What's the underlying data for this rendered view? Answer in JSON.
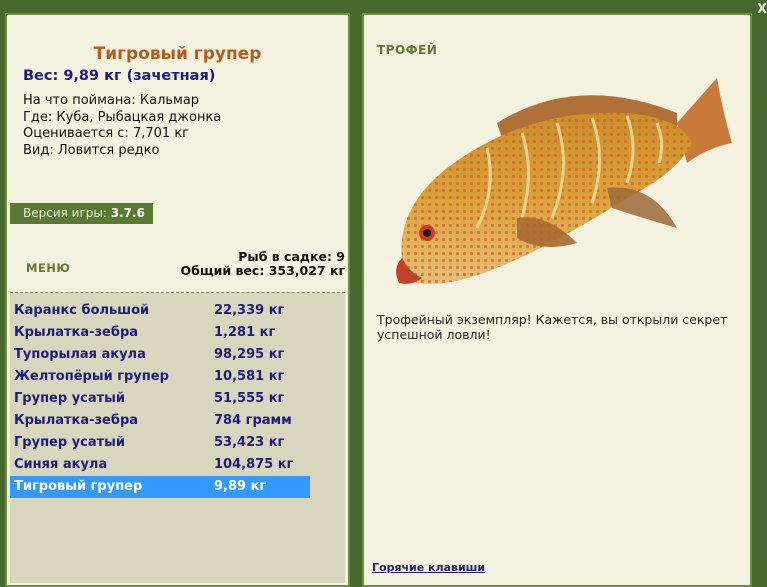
{
  "window": {
    "close_icon": "close-icon",
    "close_glyph": "X"
  },
  "left": {
    "title": "Тигровый групер",
    "weight": "Вес: 9,89 кг (зачетная)",
    "info": [
      "На что поймана: Кальмар",
      "Где: Куба, Рыбацкая джонка",
      "Оценивается с: 7,701 кг",
      "Вид: Ловится редко"
    ],
    "version_label": "Версия игры:",
    "version_value": "3.7.6",
    "menu_label": "МЕНЮ",
    "cage_count": "Рыб в садке: 9",
    "cage_weight": "Общий вес: 353,027 кг"
  },
  "catch_list": [
    {
      "name": "Каранкс большой",
      "weight": "22,339 кг"
    },
    {
      "name": "Крылатка-зебра",
      "weight": "1,281 кг"
    },
    {
      "name": "Тупорылая акула",
      "weight": "98,295 кг"
    },
    {
      "name": "Желтопёрый групер",
      "weight": "10,581 кг"
    },
    {
      "name": "Групер усатый",
      "weight": "51,555 кг"
    },
    {
      "name": "Крылатка-зебра",
      "weight": "784 грамм"
    },
    {
      "name": "Групер усатый",
      "weight": "53,423 кг"
    },
    {
      "name": "Синяя акула",
      "weight": "104,875 кг"
    },
    {
      "name": "Тигровый групер",
      "weight": "9,89 кг"
    }
  ],
  "right": {
    "trophy_label": "ТРОФЕЙ",
    "fish_image": "tiger-grouper-image",
    "message": "Трофейный экземпляр! Кажется, вы открыли секрет успешной ловли!",
    "hotkeys_link": "Горячие клавиши"
  },
  "colors": {
    "background": "#47692f",
    "panel": "#f3f1df",
    "accent_green": "#5a7a32",
    "title_orange": "#b85a1c",
    "text_navy": "#1c1c7e",
    "selection": "#3399ff"
  }
}
